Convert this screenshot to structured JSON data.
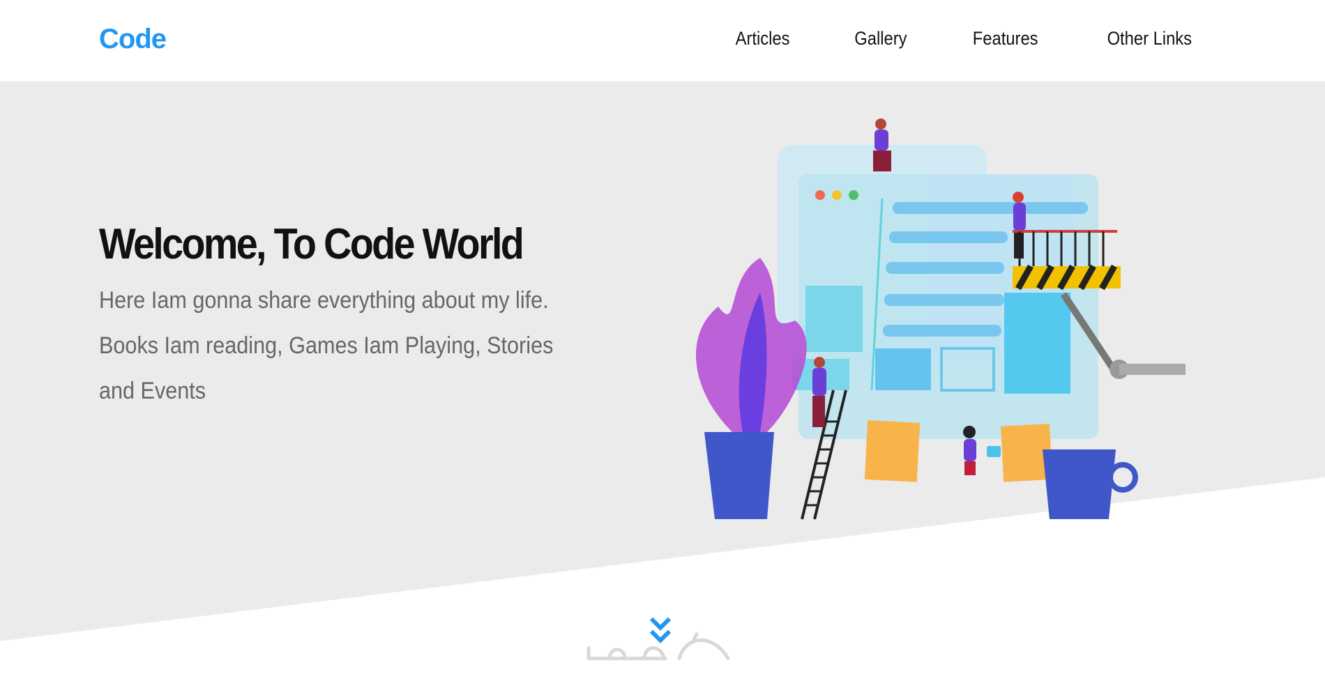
{
  "header": {
    "logo": "Code",
    "nav": [
      "Articles",
      "Gallery",
      "Features",
      "Other Links"
    ]
  },
  "hero": {
    "title": "Welcome, To Code World",
    "description": "Here Iam gonna share everything about my life. Books Iam reading, Games Iam Playing, Stories and Events"
  },
  "icons": {
    "scroll": "double-chevron-down-icon",
    "watermark": "khamsat-watermark"
  },
  "colors": {
    "brand": "#2196f3",
    "hero_bg": "#ebebeb",
    "text_dark": "#111111",
    "text_muted": "#666666"
  }
}
